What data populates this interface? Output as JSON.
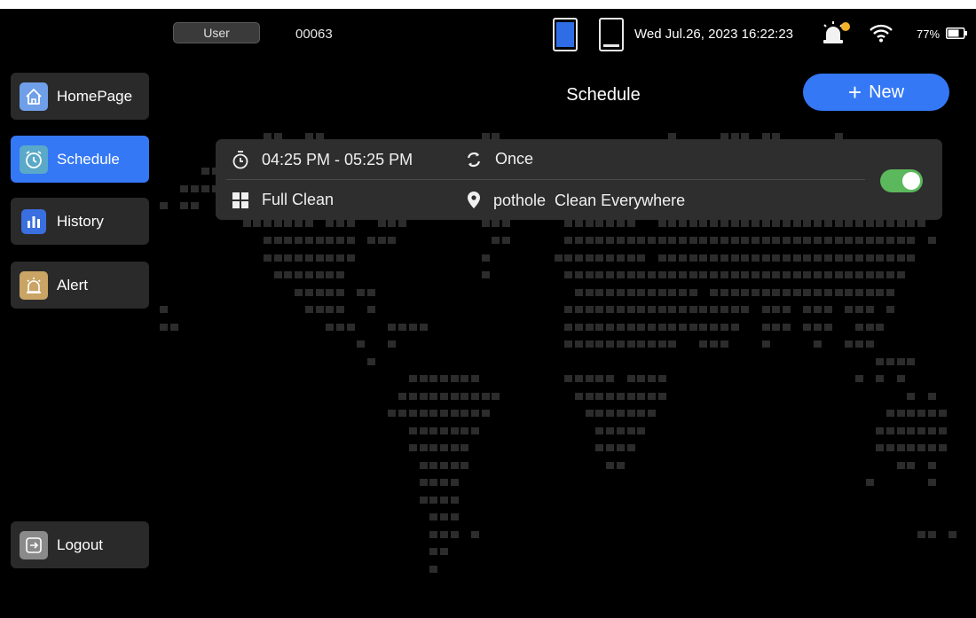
{
  "status_bar": {
    "user_label": "User",
    "device_id": "00063",
    "datetime": "Wed Jul.26, 2023 16:22:23",
    "battery_percent": "77%",
    "icons": [
      "phone-active-icon",
      "phone-inactive-icon",
      "alarm-icon",
      "wifi-icon",
      "battery-icon"
    ],
    "accent_color": "#3478f6"
  },
  "sidebar": {
    "items": [
      {
        "label": "HomePage",
        "icon": "home-icon",
        "active": false
      },
      {
        "label": "Schedule",
        "icon": "clock-icon",
        "active": true
      },
      {
        "label": "History",
        "icon": "bar-chart-icon",
        "active": false
      },
      {
        "label": "Alert",
        "icon": "alarm-icon",
        "active": false
      }
    ],
    "logout_label": "Logout"
  },
  "header": {
    "title": "Schedule",
    "new_button_label": "New"
  },
  "schedules": [
    {
      "time_range": "04:25 PM - 05:25 PM",
      "repeat": "Once",
      "mode": "Full Clean",
      "area": "pothole  Clean Everywhere",
      "enabled": true
    }
  ],
  "colors": {
    "active_blue": "#3478f6",
    "toggle_green": "#5cb85c",
    "alert_gold": "#c9a464"
  }
}
